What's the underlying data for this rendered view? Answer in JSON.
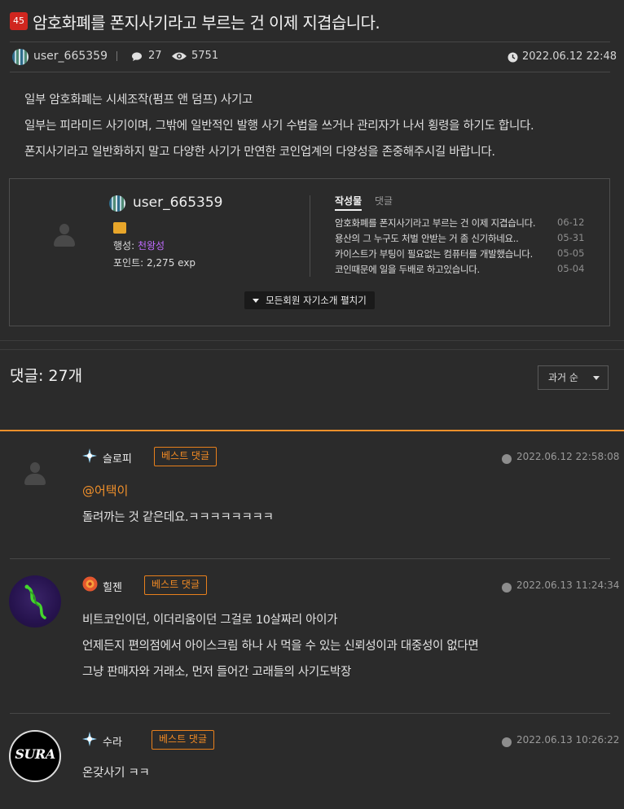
{
  "post": {
    "rank": "45",
    "title": "암호화폐를 폰지사기라고 부르는 건 이제 지겹습니다.",
    "author": "user_665359",
    "comment_count": "27",
    "view_count": "5751",
    "datetime": "2022.06.12 22:48",
    "body": [
      "일부 암호화폐는 시세조작(펌프 앤 덤프) 사기고",
      "일부는 피라미드 사기이며, 그밖에 일반적인 발행 사기 수법을 쓰거나 관리자가 나서 횡령을 하기도 합니다.",
      "폰지사기라고 일반화하지 말고 다양한 사기가 만연한 코인업계의 다양성을 존중해주시길 바랍니다."
    ]
  },
  "profile": {
    "name": "user_665359",
    "planet_label": "행성: ",
    "planet_value": "천왕성",
    "points": "포인트: 2,275 exp",
    "tab_posts": "작성물",
    "tab_comments": "댓글",
    "recent": [
      {
        "title": "암호화폐를 폰지사기라고 부르는 건 이제 지겹습니다.",
        "date": "06-12"
      },
      {
        "title": "용산의 그 누구도 처벌 안받는 거 좀 신기하네요..",
        "date": "05-31"
      },
      {
        "title": "카이스트가 부팅이 필요없는 컴퓨터를 개발했습니다.",
        "date": "05-05"
      },
      {
        "title": "코인때문에 일을 두배로 하고있습니다.",
        "date": "05-04"
      }
    ],
    "expand_label": "모든회원 자기소개 펼치기"
  },
  "comments_header": {
    "title": "댓글: 27개",
    "sort_label": "과거 순"
  },
  "comments": [
    {
      "nick": "슬로피",
      "badge": "베스트 댓글",
      "date": "2022.06.12 22:58:08",
      "mention": "@어택이",
      "lines": [
        "돌려까는 것 같은데요.ㅋㅋㅋㅋㅋㅋㅋㅋ"
      ]
    },
    {
      "nick": "힐젠",
      "badge": "베스트 댓글",
      "date": "2022.06.13 11:24:34",
      "lines": [
        "비트코인이던, 이더리움이던 그걸로 10살짜리 아이가",
        "언제든지 편의점에서 아이스크림 하나 사 먹을 수 있는 신뢰성이과 대중성이 없다면",
        "그냥 판매자와 거래소, 먼저 들어간 고래들의 사기도박장"
      ]
    },
    {
      "nick": "수라",
      "badge": "베스트 댓글",
      "date": "2022.06.13 10:26:22",
      "avatar_text": "SURA",
      "lines": [
        "온갖사기 ㅋㅋ"
      ]
    }
  ],
  "colors": {
    "background": "#2b2b2b",
    "accent_orange": "#f0902b",
    "rank_badge": "#d0261f",
    "planet_purple": "#c06bff"
  }
}
